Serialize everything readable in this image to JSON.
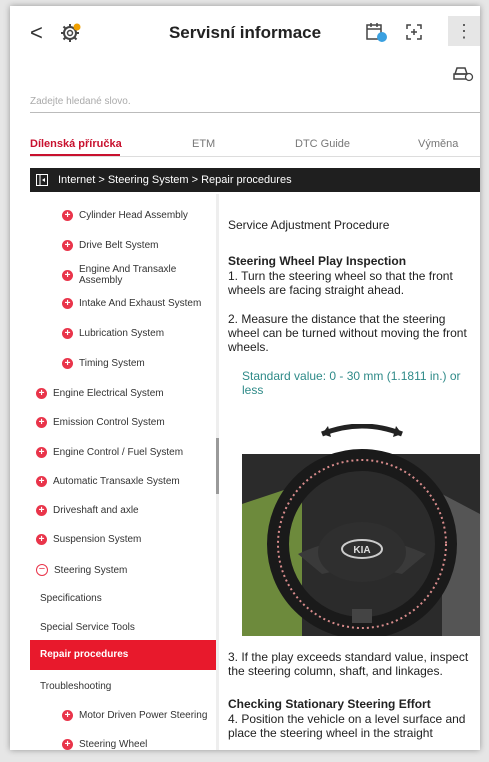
{
  "header": {
    "title": "Servisní informace",
    "back_label": "<",
    "icons": [
      "gear-icon",
      "calendar-icon",
      "expand-icon",
      "more-icon",
      "car-settings-icon"
    ]
  },
  "search": {
    "placeholder": "Zadejte hledané slovo."
  },
  "tabs": [
    {
      "label": "Dílenská příručka",
      "active": true
    },
    {
      "label": "ETM"
    },
    {
      "label": "DTC Guide"
    },
    {
      "label": "Výměna"
    }
  ],
  "breadcrumb": {
    "text": "Internet > Steering System > Repair procedures"
  },
  "sidebar": {
    "items": [
      {
        "label": "Cylinder Head Assembly"
      },
      {
        "label": "Drive Belt System"
      },
      {
        "label": "Engine And Transaxle Assembly"
      },
      {
        "label": "Intake And Exhaust System"
      },
      {
        "label": "Lubrication System"
      },
      {
        "label": "Timing System"
      },
      {
        "label": "Engine Electrical System"
      },
      {
        "label": "Emission Control System"
      },
      {
        "label": "Engine Control / Fuel System"
      },
      {
        "label": "Automatic Transaxle System"
      },
      {
        "label": "Driveshaft and axle"
      },
      {
        "label": "Suspension System"
      },
      {
        "label": "Steering System"
      },
      {
        "label": "Specifications"
      },
      {
        "label": "Special Service Tools"
      },
      {
        "label": "Repair procedures"
      },
      {
        "label": "Troubleshooting"
      },
      {
        "label": "Motor Driven Power Steering"
      },
      {
        "label": "Steering Wheel"
      }
    ]
  },
  "content": {
    "section_title": "Service Adjustment Procedure",
    "heading1": "Steering Wheel Play Inspection",
    "step1": "1. Turn the steering wheel so that the front wheels are facing straight ahead.",
    "step2": "2. Measure the distance that the steering wheel can be turned without moving the front wheels.",
    "standard": "Standard value: 0 - 30 mm (1.1811 in.) or less",
    "image_logo": "KIA",
    "step3": "3. If the play exceeds standard value, inspect the steering column, shaft, and linkages.",
    "heading2": "Checking Stationary Steering Effort",
    "step4": "4. Position the vehicle on a level surface and place the steering wheel in the straight"
  },
  "colors": {
    "accent": "#e8192c",
    "standard_text": "#2e8a88",
    "breadcrumb_bg": "#1f1f1f"
  }
}
